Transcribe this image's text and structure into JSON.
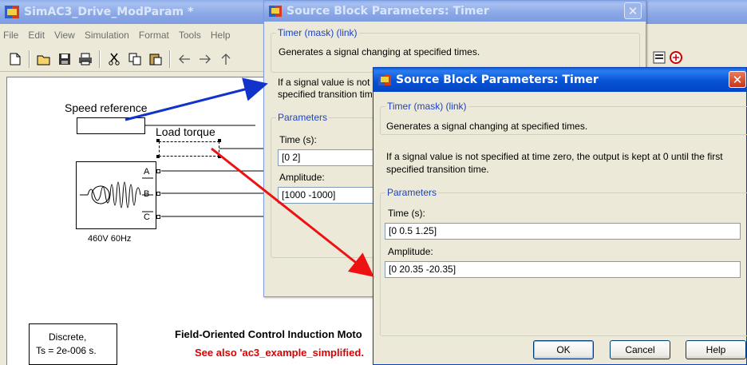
{
  "main": {
    "title": "SimAC3_Drive_ModParam *",
    "menu": [
      "File",
      "Edit",
      "View",
      "Simulation",
      "Format",
      "Tools",
      "Help"
    ],
    "canvas": {
      "speed_ref_label": "Speed reference",
      "load_torque_label": "Load torque",
      "source_label": "460V 60Hz",
      "port_a": "A",
      "port_b": "B",
      "port_c": "C",
      "discrete_line1": "Discrete,",
      "discrete_line2": "Ts = 2e-006 s.",
      "model_title": "Field-Oriented Control Induction Moto",
      "see_also": "See also 'ac3_example_simplified."
    }
  },
  "dialog_back": {
    "title": "Source Block Parameters: Timer",
    "mask_legend": "Timer (mask) (link)",
    "description": "Generates a signal changing at specified times.",
    "note_line1": "If a signal value is not",
    "note_line2": "specified transition tim",
    "params_legend": "Parameters",
    "time_label": "Time (s):",
    "time_value": "[0 2]",
    "amplitude_label": "Amplitude:",
    "amplitude_value": "[1000 -1000]"
  },
  "dialog_front": {
    "title": "Source Block Parameters: Timer",
    "mask_legend": "Timer (mask) (link)",
    "description": "Generates a signal changing at specified times.",
    "note_line1": "If a signal value is not specified at time zero, the output is kept at 0 until the first",
    "note_line2": "specified transition time.",
    "params_legend": "Parameters",
    "time_label": "Time (s):",
    "time_value": "[0 0.5 1.25]",
    "amplitude_label": "Amplitude:",
    "amplitude_value": "[0 20.35 -20.35]",
    "ok_label": "OK",
    "cancel_label": "Cancel",
    "help_label": "Help"
  },
  "colors": {
    "arrow_blue": "#1133cc",
    "arrow_red": "#ee1111",
    "see_also_red": "#dd0000"
  }
}
